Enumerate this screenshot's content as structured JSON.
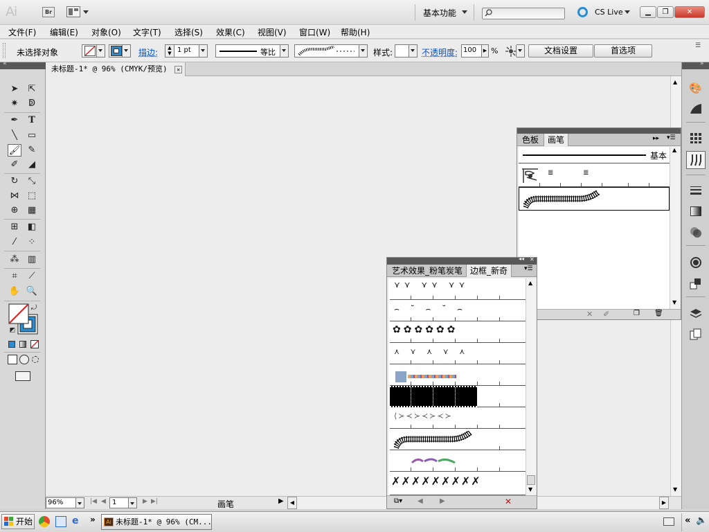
{
  "app": {
    "logo": "Ai",
    "bridge_badge": "Br",
    "workspace": "基本功能",
    "cs_live": "CS Live",
    "window_close": "✕"
  },
  "menu": [
    "文件(F)",
    "编辑(E)",
    "对象(O)",
    "文字(T)",
    "选择(S)",
    "效果(C)",
    "视图(V)",
    "窗口(W)",
    "帮助(H)"
  ],
  "control": {
    "no_selection": "未选择对象",
    "stroke_label": "描边:",
    "stroke_weight": "1 pt",
    "stroke_profile": "等比",
    "style_label": "样式:",
    "opacity_label": "不透明度:",
    "opacity_value": "100",
    "opacity_unit": "%",
    "doc_setup": "文档设置",
    "preferences": "首选项"
  },
  "document": {
    "tab_title": "未标题-1* @ 96% (CMYK/预览)",
    "zoom": "96%",
    "page": "1",
    "status": "画笔"
  },
  "brush_panel": {
    "tabs": [
      "色板",
      "画笔"
    ],
    "basic_label": "基本"
  },
  "library_panel": {
    "tabs": [
      "艺术效果_粉笔炭笔",
      "边框_新奇"
    ]
  },
  "taskbar": {
    "start": "开始",
    "task": "未标题-1* @ 96% (CM..."
  },
  "colors": {
    "accent_blue": "#2b8ccf",
    "fill_none_red": "#d22222"
  }
}
